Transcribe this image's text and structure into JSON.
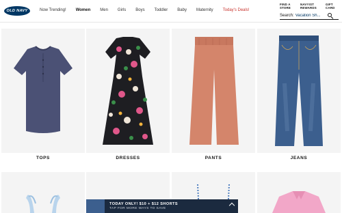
{
  "brand": {
    "logo_text": "OLD NAVY"
  },
  "nav": {
    "items": [
      {
        "label": "Now Trending!"
      },
      {
        "label": "Women"
      },
      {
        "label": "Men"
      },
      {
        "label": "Girls"
      },
      {
        "label": "Boys"
      },
      {
        "label": "Toddler"
      },
      {
        "label": "Baby"
      },
      {
        "label": "Maternity"
      },
      {
        "label": "Today's Deals!"
      }
    ],
    "active": "Women"
  },
  "utility": {
    "store": [
      "FIND A",
      "STORE"
    ],
    "rewards": [
      "NAVYIST",
      "REWARDS"
    ],
    "gift": [
      "GIFT",
      "CARD"
    ]
  },
  "search": {
    "label": "Search:",
    "value": "Vacation Sh..."
  },
  "categories": [
    {
      "label": "TOPS"
    },
    {
      "label": "DRESSES"
    },
    {
      "label": "PANTS"
    },
    {
      "label": "JEANS"
    }
  ],
  "promo": {
    "headline": "TODAY ONLY! $10 + $12 SHORTS",
    "subline": "TAP FOR MORE WAYS TO SAVE"
  },
  "colors": {
    "brand_navy": "#003764",
    "deal_red": "#c8322c",
    "promo_bg": "#1b2a3f"
  }
}
